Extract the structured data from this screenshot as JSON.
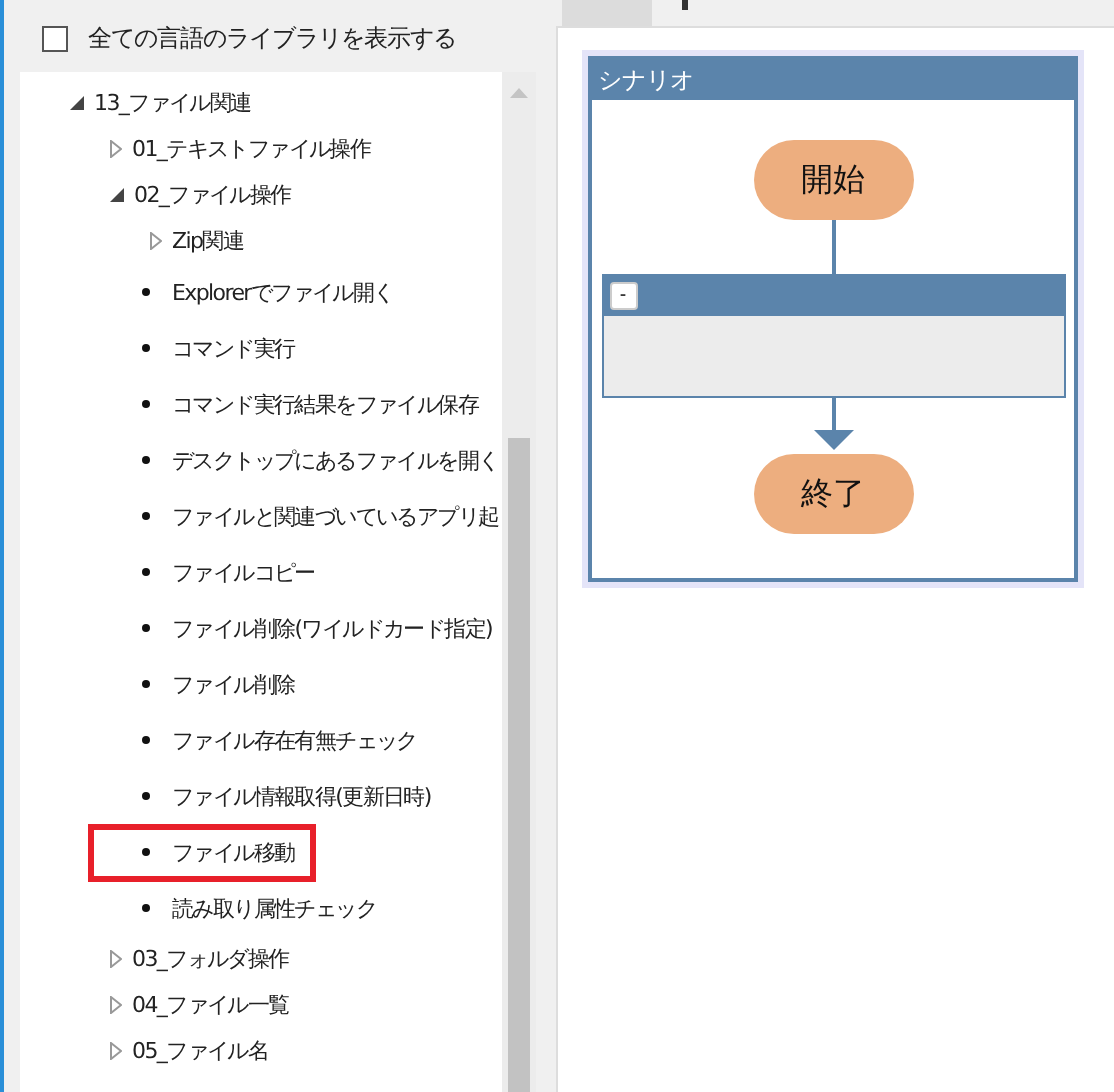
{
  "library_option": {
    "label": "全ての言語のライブラリを表示する",
    "checked": false
  },
  "tree": [
    {
      "label": "13_ファイル関連",
      "kind": "folder",
      "expanded": true,
      "children": [
        {
          "label": "01_テキストファイル操作",
          "kind": "folder",
          "expanded": false
        },
        {
          "label": "02_ファイル操作",
          "kind": "folder",
          "expanded": true,
          "children": [
            {
              "label": "Zip関連",
              "kind": "folder",
              "expanded": false
            },
            {
              "label": "Explorerでファイル開く",
              "kind": "leaf",
              "highlighted": false
            },
            {
              "label": "コマンド実行",
              "kind": "leaf",
              "highlighted": false
            },
            {
              "label": "コマンド実行結果をファイル保存",
              "kind": "leaf",
              "highlighted": false
            },
            {
              "label": "デスクトップにあるファイルを開く",
              "kind": "leaf",
              "highlighted": false
            },
            {
              "label": "ファイルと関連づいているアプリ起",
              "kind": "leaf",
              "highlighted": false
            },
            {
              "label": "ファイルコピー",
              "kind": "leaf",
              "highlighted": false
            },
            {
              "label": "ファイル削除(ワイルドカード指定)",
              "kind": "leaf",
              "highlighted": false
            },
            {
              "label": "ファイル削除",
              "kind": "leaf",
              "highlighted": false
            },
            {
              "label": "ファイル存在有無チェック",
              "kind": "leaf",
              "highlighted": false
            },
            {
              "label": "ファイル情報取得(更新日時)",
              "kind": "leaf",
              "highlighted": false
            },
            {
              "label": "ファイル移動",
              "kind": "leaf",
              "highlighted": true
            },
            {
              "label": "読み取り属性チェック",
              "kind": "leaf",
              "highlighted": false
            }
          ]
        },
        {
          "label": "03_フォルダ操作",
          "kind": "folder",
          "expanded": false
        },
        {
          "label": "04_ファイル一覧",
          "kind": "folder",
          "expanded": false
        },
        {
          "label": "05_ファイル名",
          "kind": "folder",
          "expanded": false
        }
      ]
    }
  ],
  "scenario": {
    "title": "シナリオ",
    "start": "開始",
    "group": {
      "collapse_button": "-"
    },
    "end": "終了"
  }
}
